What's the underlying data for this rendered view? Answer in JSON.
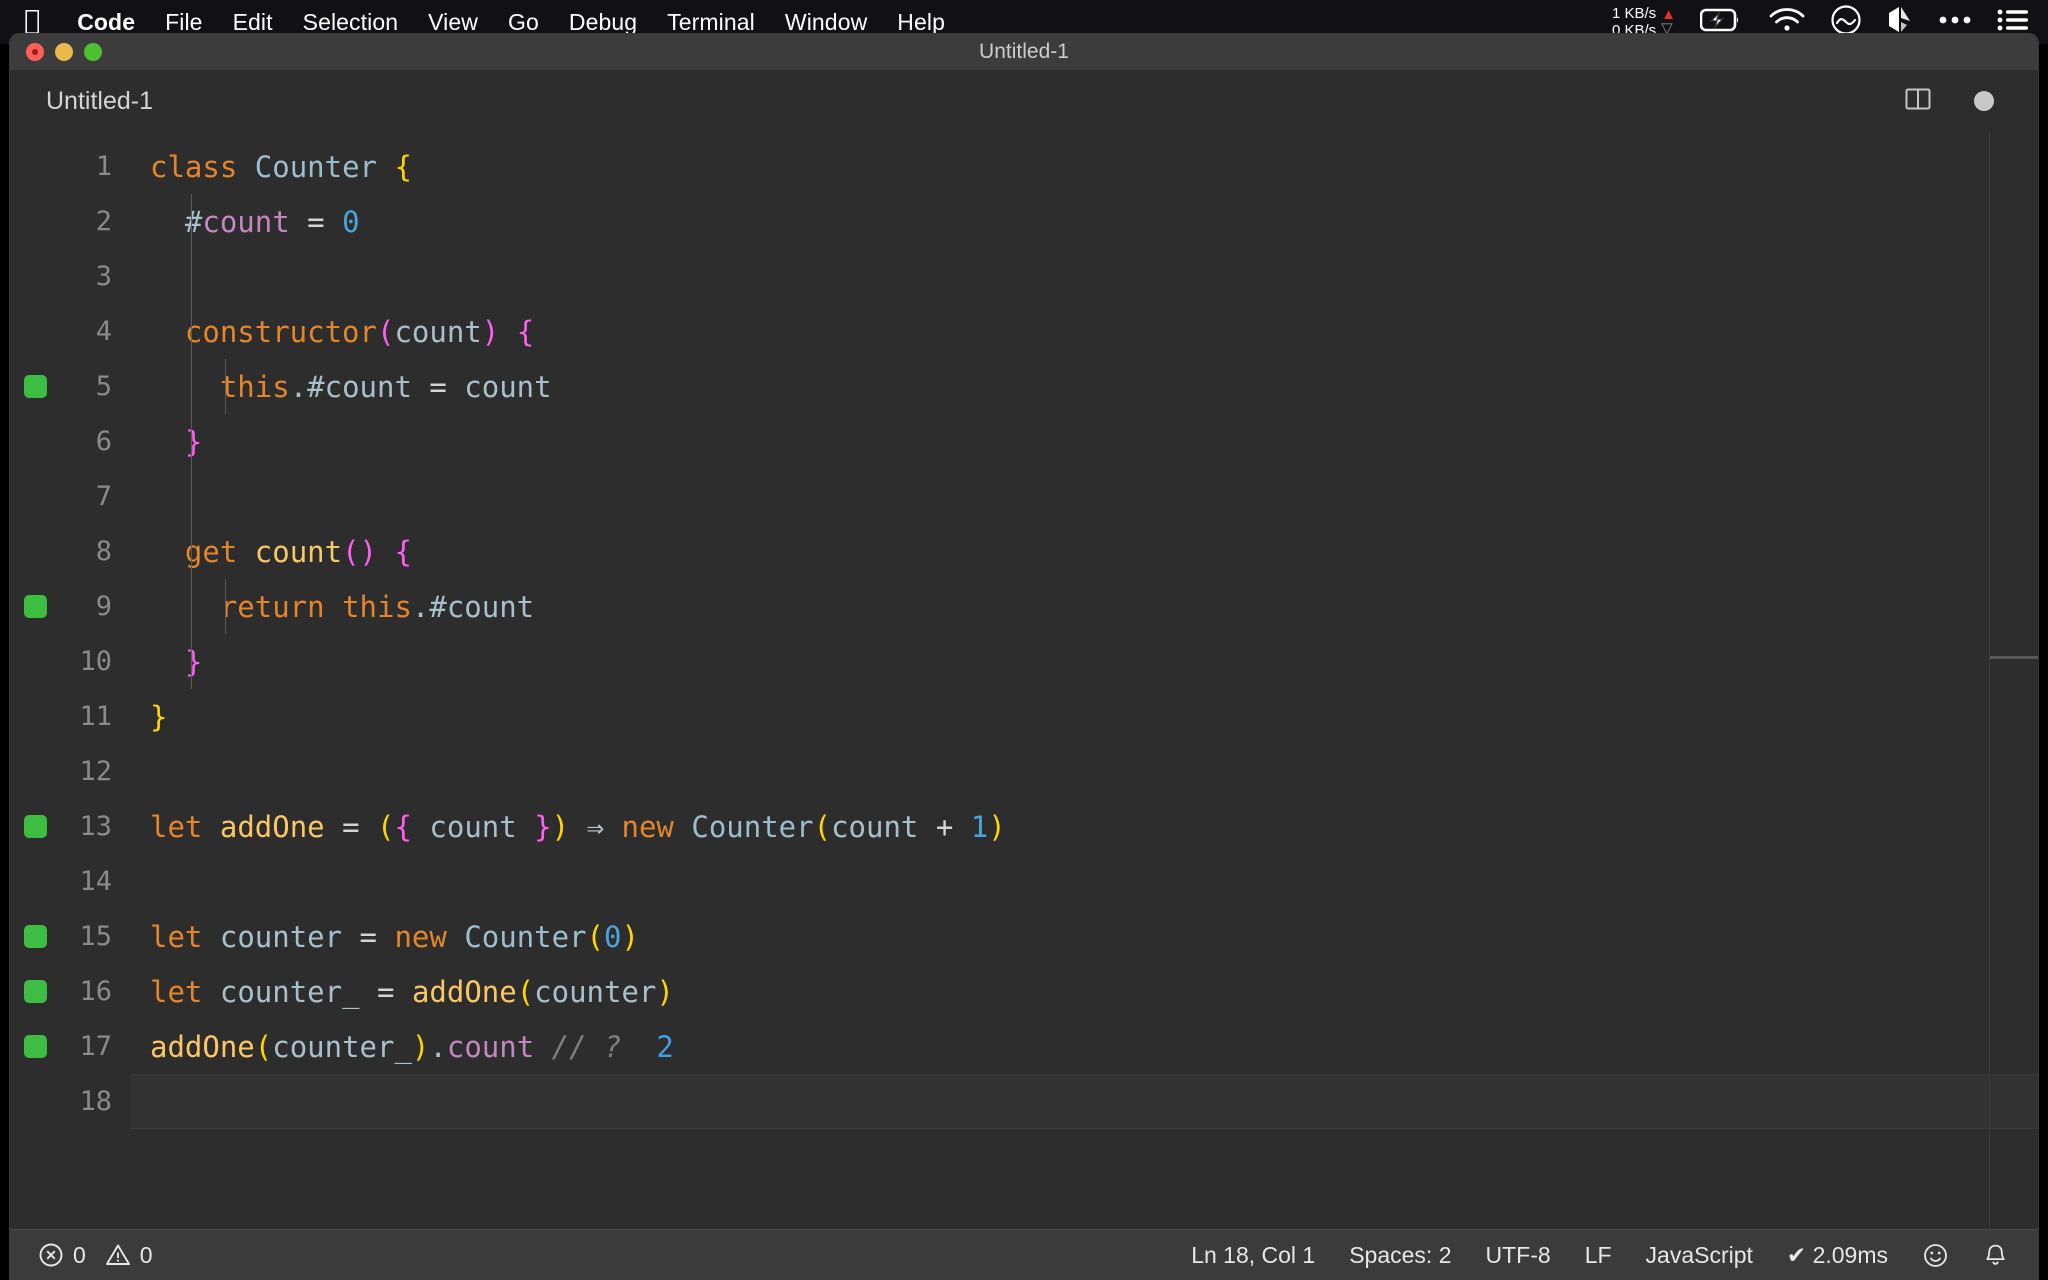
{
  "menubar": {
    "apple_logo": "apple-logo-icon",
    "items": [
      {
        "label": "Code",
        "bold": true
      },
      {
        "label": "File",
        "bold": false
      },
      {
        "label": "Edit",
        "bold": false
      },
      {
        "label": "Selection",
        "bold": false
      },
      {
        "label": "View",
        "bold": false
      },
      {
        "label": "Go",
        "bold": false
      },
      {
        "label": "Debug",
        "bold": false
      },
      {
        "label": "Terminal",
        "bold": false
      },
      {
        "label": "Window",
        "bold": false
      },
      {
        "label": "Help",
        "bold": false
      }
    ],
    "status": {
      "net_up": "1 KB/s",
      "net_down": "0 KB/s",
      "up_arrow_color": "#e8302a",
      "down_arrow_color": "#8a8a8a",
      "icons": [
        "battery-charging-icon",
        "wifi-icon",
        "bluelight-icon",
        "dropbox-icon",
        "ellipsis-icon",
        "control-center-icon"
      ]
    }
  },
  "window": {
    "title": "Untitled-1",
    "traffic_lights": [
      "close-button",
      "minimize-button",
      "maximize-button"
    ]
  },
  "tabbar": {
    "tab_label": "Untitled-1",
    "split_editor_icon": "split-editor-icon",
    "dirty_indicator": "unsaved-dot-icon"
  },
  "editor": {
    "language": "JavaScript",
    "quokka_lines": [
      5,
      9,
      13,
      15,
      16,
      17
    ],
    "current_line": 18,
    "lines": [
      {
        "n": "1",
        "indent": 0,
        "tokens": [
          {
            "t": "class",
            "c": "t-key"
          },
          {
            "t": " ",
            "c": "t-op"
          },
          {
            "t": "Counter",
            "c": "t-type"
          },
          {
            "t": " ",
            "c": "t-op"
          },
          {
            "t": "{",
            "c": "t-br-y"
          }
        ]
      },
      {
        "n": "2",
        "indent": 1,
        "tokens": [
          {
            "t": "  ",
            "c": "t-op"
          },
          {
            "t": "#",
            "c": "t-var"
          },
          {
            "t": "count",
            "c": "t-prop"
          },
          {
            "t": " = ",
            "c": "t-op"
          },
          {
            "t": "0",
            "c": "t-num"
          }
        ]
      },
      {
        "n": "3",
        "indent": 1,
        "tokens": []
      },
      {
        "n": "4",
        "indent": 1,
        "tokens": [
          {
            "t": "  ",
            "c": "t-op"
          },
          {
            "t": "constructor",
            "c": "t-key"
          },
          {
            "t": "(",
            "c": "t-br-m"
          },
          {
            "t": "count",
            "c": "t-var"
          },
          {
            "t": ")",
            "c": "t-br-m"
          },
          {
            "t": " ",
            "c": "t-op"
          },
          {
            "t": "{",
            "c": "t-br-m"
          }
        ]
      },
      {
        "n": "5",
        "indent": 2,
        "tokens": [
          {
            "t": "    ",
            "c": "t-op"
          },
          {
            "t": "this",
            "c": "t-key"
          },
          {
            "t": ".#count",
            "c": "t-var"
          },
          {
            "t": " = ",
            "c": "t-op"
          },
          {
            "t": "count",
            "c": "t-var"
          }
        ]
      },
      {
        "n": "6",
        "indent": 1,
        "tokens": [
          {
            "t": "  ",
            "c": "t-op"
          },
          {
            "t": "}",
            "c": "t-br-m"
          }
        ]
      },
      {
        "n": "7",
        "indent": 1,
        "tokens": []
      },
      {
        "n": "8",
        "indent": 1,
        "tokens": [
          {
            "t": "  ",
            "c": "t-op"
          },
          {
            "t": "get",
            "c": "t-key"
          },
          {
            "t": " ",
            "c": "t-op"
          },
          {
            "t": "count",
            "c": "t-fn"
          },
          {
            "t": "()",
            "c": "t-br-m"
          },
          {
            "t": " ",
            "c": "t-op"
          },
          {
            "t": "{",
            "c": "t-br-m"
          }
        ]
      },
      {
        "n": "9",
        "indent": 2,
        "tokens": [
          {
            "t": "    ",
            "c": "t-op"
          },
          {
            "t": "return",
            "c": "t-key"
          },
          {
            "t": " ",
            "c": "t-op"
          },
          {
            "t": "this",
            "c": "t-key"
          },
          {
            "t": ".#count",
            "c": "t-var"
          }
        ]
      },
      {
        "n": "10",
        "indent": 1,
        "tokens": [
          {
            "t": "  ",
            "c": "t-op"
          },
          {
            "t": "}",
            "c": "t-br-m"
          }
        ]
      },
      {
        "n": "11",
        "indent": 0,
        "tokens": [
          {
            "t": "}",
            "c": "t-br-y"
          }
        ]
      },
      {
        "n": "12",
        "indent": 0,
        "tokens": []
      },
      {
        "n": "13",
        "indent": 0,
        "tokens": [
          {
            "t": "let",
            "c": "t-key"
          },
          {
            "t": " ",
            "c": "t-op"
          },
          {
            "t": "addOne",
            "c": "t-fn"
          },
          {
            "t": " = ",
            "c": "t-op"
          },
          {
            "t": "(",
            "c": "t-br-y"
          },
          {
            "t": "{",
            "c": "t-br-m"
          },
          {
            "t": " count ",
            "c": "t-var"
          },
          {
            "t": "}",
            "c": "t-br-m"
          },
          {
            "t": ")",
            "c": "t-br-y"
          },
          {
            "t": " ",
            "c": "t-op"
          },
          {
            "t": "⇒",
            "c": "t-arrow"
          },
          {
            "t": " ",
            "c": "t-op"
          },
          {
            "t": "new",
            "c": "t-key"
          },
          {
            "t": " ",
            "c": "t-op"
          },
          {
            "t": "Counter",
            "c": "t-type"
          },
          {
            "t": "(",
            "c": "t-br-y"
          },
          {
            "t": "count",
            "c": "t-var"
          },
          {
            "t": " + ",
            "c": "t-op"
          },
          {
            "t": "1",
            "c": "t-num"
          },
          {
            "t": ")",
            "c": "t-br-y"
          }
        ]
      },
      {
        "n": "14",
        "indent": 0,
        "tokens": []
      },
      {
        "n": "15",
        "indent": 0,
        "tokens": [
          {
            "t": "let",
            "c": "t-key"
          },
          {
            "t": " ",
            "c": "t-op"
          },
          {
            "t": "counter",
            "c": "t-var"
          },
          {
            "t": " = ",
            "c": "t-op"
          },
          {
            "t": "new",
            "c": "t-key"
          },
          {
            "t": " ",
            "c": "t-op"
          },
          {
            "t": "Counter",
            "c": "t-type"
          },
          {
            "t": "(",
            "c": "t-br-y"
          },
          {
            "t": "0",
            "c": "t-num"
          },
          {
            "t": ")",
            "c": "t-br-y"
          }
        ]
      },
      {
        "n": "16",
        "indent": 0,
        "tokens": [
          {
            "t": "let",
            "c": "t-key"
          },
          {
            "t": " ",
            "c": "t-op"
          },
          {
            "t": "counter_",
            "c": "t-var"
          },
          {
            "t": " = ",
            "c": "t-op"
          },
          {
            "t": "addOne",
            "c": "t-fn"
          },
          {
            "t": "(",
            "c": "t-br-y"
          },
          {
            "t": "counter",
            "c": "t-var"
          },
          {
            "t": ")",
            "c": "t-br-y"
          }
        ]
      },
      {
        "n": "17",
        "indent": 0,
        "tokens": [
          {
            "t": "addOne",
            "c": "t-fn"
          },
          {
            "t": "(",
            "c": "t-br-y"
          },
          {
            "t": "counter_",
            "c": "t-var"
          },
          {
            "t": ")",
            "c": "t-br-y"
          },
          {
            "t": ".",
            "c": "t-var"
          },
          {
            "t": "count",
            "c": "t-prop"
          },
          {
            "t": " ",
            "c": "t-op"
          },
          {
            "t": "// ?",
            "c": "t-comment"
          },
          {
            "t": "  ",
            "c": "t-op"
          },
          {
            "t": "2",
            "c": "t-val"
          }
        ]
      },
      {
        "n": "18",
        "indent": 0,
        "tokens": []
      }
    ]
  },
  "statusbar": {
    "errors_icon": "error-circle-icon",
    "errors_count": "0",
    "warnings_icon": "warning-triangle-icon",
    "warnings_count": "0",
    "cursor_position": "Ln 18, Col 1",
    "indentation": "Spaces: 2",
    "encoding": "UTF-8",
    "eol": "LF",
    "language_mode": "JavaScript",
    "quokka_status": "✔ 2.09ms",
    "feedback_icon": "smiley-icon",
    "notifications_icon": "bell-icon"
  },
  "colors": {
    "editor_bg": "#2d2d2d",
    "titlebar_bg": "#3c3c3c",
    "statusbar_bg": "#3b3b3b",
    "quokka_green": "#3ebd43",
    "keyword_orange": "#e4852a",
    "bracket_yellow": "#ffd602",
    "bracket_magenta": "#ff5ff0",
    "number_blue": "#4aa5dc",
    "property_purple": "#c586c0"
  }
}
